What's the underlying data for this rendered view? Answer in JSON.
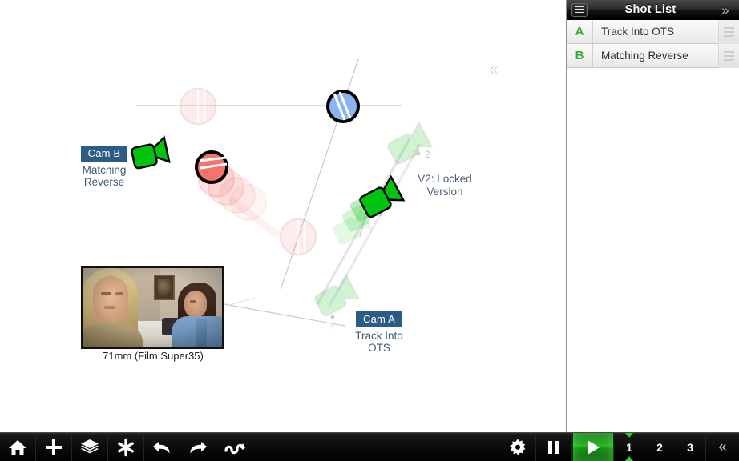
{
  "canvas": {
    "cam_b": {
      "chip": "Cam B",
      "sub": "Matching\nReverse"
    },
    "cam_a": {
      "chip": "Cam A",
      "sub": "Track Into\nOTS"
    },
    "version_note": "V2: Locked\nVersion",
    "ghost_marker_2": "2",
    "ghost_marker_1": "1",
    "collapse_chevron": "«",
    "preview_caption": "71mm (Film Super35)",
    "colors": {
      "subject_blue": "#89b4ef",
      "subject_red": "#f4736b",
      "camera_green": "#00c40f",
      "chip_blue": "#2b5c86",
      "label_text": "#3f5a78"
    }
  },
  "sidebar": {
    "title": "Shot List",
    "menu_icon": "hamburger-icon",
    "collapse_icon": "»",
    "shots": [
      {
        "letter": "A",
        "name": "Track Into OTS"
      },
      {
        "letter": "B",
        "name": "Matching Reverse"
      }
    ]
  },
  "toolbar": {
    "left_buttons": [
      {
        "name": "home-icon",
        "label": "Home"
      },
      {
        "name": "add-icon",
        "label": "Add"
      },
      {
        "name": "layers-icon",
        "label": "Layers"
      },
      {
        "name": "snap-icon",
        "label": "Snap"
      },
      {
        "name": "undo-icon",
        "label": "Undo"
      },
      {
        "name": "redo-icon",
        "label": "Redo"
      },
      {
        "name": "path-icon",
        "label": "Path"
      }
    ],
    "right_buttons": [
      {
        "name": "gear-icon",
        "label": "Settings"
      },
      {
        "name": "pause-icon",
        "label": "Pause"
      },
      {
        "name": "play-icon",
        "label": "Play"
      }
    ],
    "frames": [
      "1",
      "2",
      "3"
    ],
    "active_frame": "1",
    "collapse_icon": "«"
  }
}
